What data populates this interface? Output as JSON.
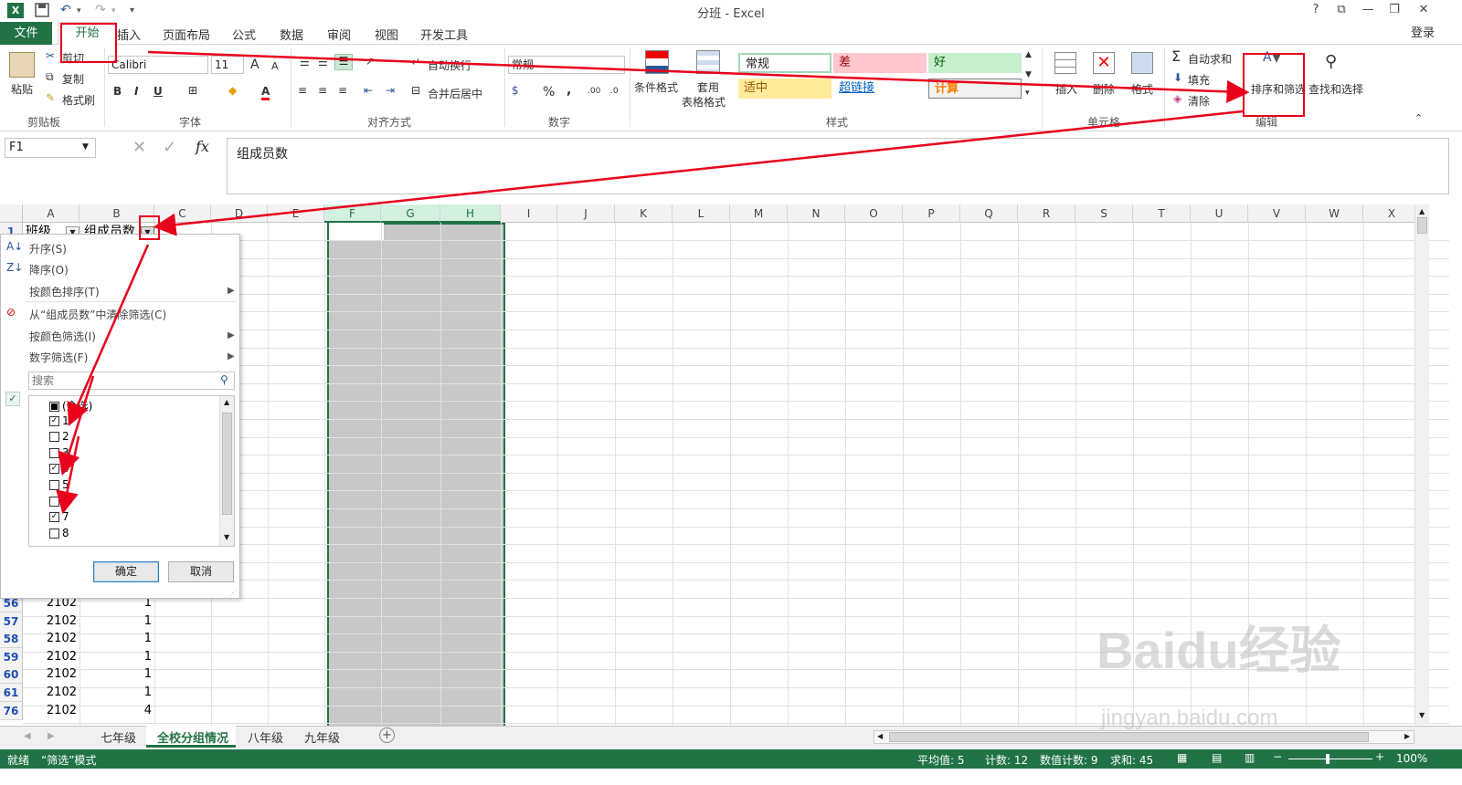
{
  "window": {
    "title": "分班 - Excel",
    "signin": "登录",
    "help": "?",
    "restore_btn": "⧉",
    "minimize": "—",
    "maximize": "❐",
    "close": "✕"
  },
  "quick_access": {
    "save_icon": "floppy",
    "undo_icon": "undo",
    "redo_icon": "redo"
  },
  "tabs": [
    "文件",
    "开始",
    "插入",
    "页面布局",
    "公式",
    "数据",
    "审阅",
    "视图",
    "开发工具"
  ],
  "ribbon": {
    "clipboard": {
      "paste": "粘贴",
      "cut": "剪切",
      "copy": "复制",
      "format_painter": "格式刷",
      "label": "剪贴板"
    },
    "font": {
      "name": "Calibri",
      "size": "11",
      "label": "字体",
      "bold": "B",
      "italic": "I",
      "underline": "U",
      "grow": "A",
      "shrink": "A",
      "font_color": "A"
    },
    "alignment": {
      "wrap": "自动换行",
      "merge": "合并后居中",
      "label": "对齐方式"
    },
    "number": {
      "format": "常规",
      "label": "数字",
      "percent": "%",
      "comma": ",",
      "inc_decimal": ".00",
      "dec_decimal": ".0"
    },
    "styles": {
      "conditional": "条件格式",
      "table_format": "套用",
      "table_format2": "表格格式",
      "normal": "常规",
      "bad": "差",
      "good": "好",
      "neutral": "适中",
      "hyperlink": "超链接",
      "calculation": "计算",
      "label": "样式"
    },
    "cells": {
      "insert": "插入",
      "delete": "删除",
      "format": "格式",
      "label": "单元格"
    },
    "editing": {
      "autosum": "自动求和",
      "fill": "填充",
      "clear": "清除",
      "sort_filter": "排序和筛选",
      "find_select": "查找和选择",
      "label": "编辑"
    }
  },
  "formula_bar": {
    "name_box": "F1",
    "content": "组成员数",
    "fx": "fx"
  },
  "columns": [
    "A",
    "B",
    "C",
    "D",
    "E",
    "F",
    "G",
    "H",
    "I",
    "J",
    "K",
    "L",
    "M",
    "N",
    "O",
    "P",
    "Q",
    "R",
    "S",
    "T",
    "U",
    "V",
    "W",
    "X"
  ],
  "header_row": {
    "row": "1",
    "a": "班级",
    "b": "组成员数"
  },
  "rows": [
    {
      "num": "56",
      "a": "2102",
      "b": "1"
    },
    {
      "num": "57",
      "a": "2102",
      "b": "1"
    },
    {
      "num": "58",
      "a": "2102",
      "b": "1"
    },
    {
      "num": "59",
      "a": "2102",
      "b": "1"
    },
    {
      "num": "60",
      "a": "2102",
      "b": "1"
    },
    {
      "num": "61",
      "a": "2102",
      "b": "1"
    },
    {
      "num": "76",
      "a": "2102",
      "b": "4"
    }
  ],
  "filter_menu": {
    "sort_asc": "升序(S)",
    "sort_desc": "降序(O)",
    "sort_color": "按颜色排序(T)",
    "clear_filter": "从“组成员数”中清除筛选(C)",
    "filter_color": "按颜色筛选(I)",
    "number_filter": "数字筛选(F)",
    "search_placeholder": "搜索",
    "items": [
      {
        "label": "(全选)",
        "state": "partial"
      },
      {
        "label": "1",
        "state": "checked"
      },
      {
        "label": "2",
        "state": "unchecked"
      },
      {
        "label": "3",
        "state": "unchecked"
      },
      {
        "label": "4",
        "state": "checked"
      },
      {
        "label": "5",
        "state": "unchecked"
      },
      {
        "label": "6",
        "state": "unchecked"
      },
      {
        "label": "7",
        "state": "checked"
      },
      {
        "label": "8",
        "state": "unchecked"
      }
    ],
    "ok": "确定",
    "cancel": "取消"
  },
  "sheets": [
    "七年级",
    "全校分组情况",
    "八年级",
    "九年级"
  ],
  "active_sheet": "全校分组情况",
  "status": {
    "ready": "就绪",
    "mode": "“筛选”模式",
    "average": "平均值: 5",
    "count": "计数: 12",
    "numeric_count": "数值计数: 9",
    "sum": "求和: 45",
    "zoom": "100%"
  },
  "watermark": {
    "brand": "Baidu经验",
    "url": "jingyan.baidu.com"
  },
  "colors": {
    "excel_green": "#217346",
    "annotation_red": "#e8001c",
    "selected_gray": "#c8c8c8"
  }
}
